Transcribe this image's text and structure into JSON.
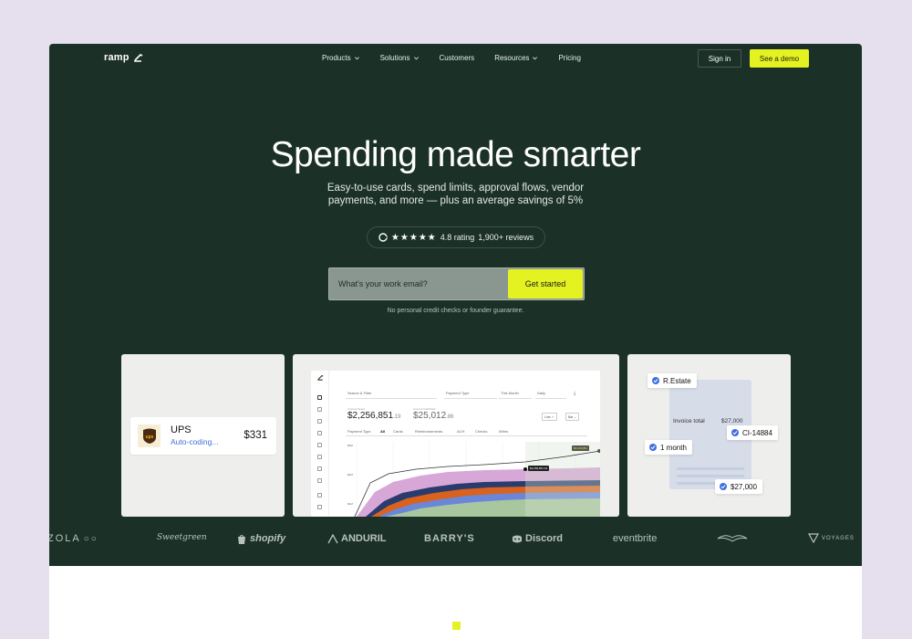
{
  "nav": {
    "logo": "ramp",
    "items": [
      {
        "label": "Products",
        "dropdown": true
      },
      {
        "label": "Solutions",
        "dropdown": true
      },
      {
        "label": "Customers",
        "dropdown": false
      },
      {
        "label": "Resources",
        "dropdown": true
      },
      {
        "label": "Pricing",
        "dropdown": false
      }
    ],
    "sign_in": "Sign in",
    "demo": "See a demo"
  },
  "hero": {
    "headline": "Spending made smarter",
    "sub_line1": "Easy-to-use cards, spend limits, approval flows, vendor",
    "sub_line2": "payments, and more — plus an average savings of 5%",
    "rating_stars": "★★★★★",
    "rating_text": "4.8 rating",
    "reviews": "1,900+ reviews",
    "email_placeholder": "What's your work email?",
    "cta": "Get started",
    "disclaimer": "No personal credit checks or founder guarantee."
  },
  "card_left": {
    "vendor": "UPS",
    "status": "Auto-coding...",
    "amount": "$331"
  },
  "card_mid": {
    "search": "Search & Filter",
    "payment_type": "Payment Type",
    "period": "This Month",
    "interval": "Daily",
    "amount1_label": "Amount Spent",
    "amount1": "$2,256,851",
    "amount1_cents": ".19",
    "amount2_label": "Amount Cashback",
    "amount2": "$25,012",
    "amount2_cents": ".86",
    "tabs": [
      "Payment Type",
      "All",
      "Cards",
      "Reimbursements",
      "ACH",
      "Checks",
      "Wires"
    ],
    "tooltip1": "$2,256,851.19",
    "tooltip2": "$3,234,851",
    "y_ticks": [
      "$3M",
      "$2M",
      "$1M"
    ]
  },
  "card_right": {
    "chip_vendor": "R.Estate",
    "invoice_label": "Invoice total",
    "invoice_value": "$27,000",
    "chip_id": "CI-14884",
    "chip_term": "1 month",
    "chip_amount": "$27,000"
  },
  "logos": [
    "ZOLA",
    "Sweetgreen",
    "shopify",
    "ANDURIL",
    "BARRY'S",
    "Discord",
    "eventbrite",
    "Brand",
    "VOYAGES"
  ],
  "colors": {
    "bg": "#1b3128",
    "accent": "#e4f221",
    "page": "#e6e0ee"
  }
}
